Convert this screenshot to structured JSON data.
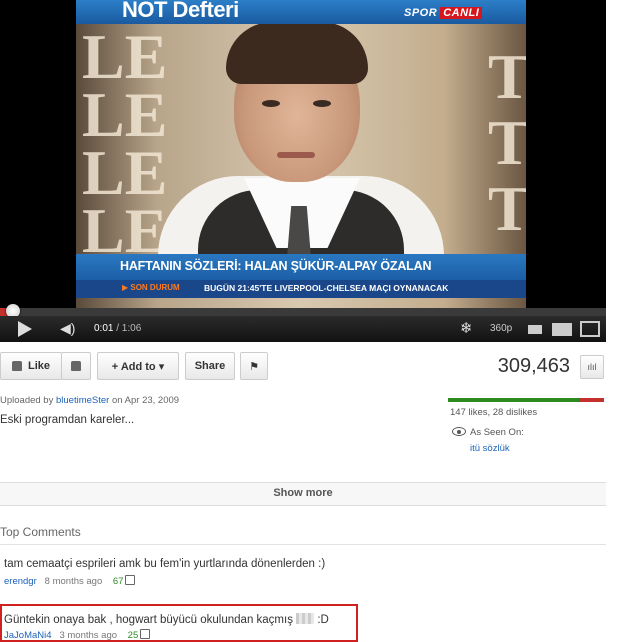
{
  "video": {
    "show_title": "NOT Defteri",
    "channel_logo_a": "SPOR",
    "channel_logo_b": "CANLI",
    "wall_letters": [
      "LE",
      "LE",
      "LE",
      "LE",
      "T",
      "T",
      "T"
    ],
    "caption": "HAFTANIN SÖZLERİ: HALAN ŞÜKÜR-ALPAY ÖZALAN",
    "ticker_label": "▶ SON DURUM",
    "ticker_text": "BUGÜN 21:45'TE LIVERPOOL-CHELSEA MAÇI OYNANACAK"
  },
  "player": {
    "current_time": "0:01",
    "duration": "/ 1:06",
    "progress_fraction": 0.015,
    "quality": "360p",
    "icons": [
      "play-icon",
      "volume-icon",
      "annotations-icon",
      "small-player-icon",
      "large-player-icon",
      "fullscreen-icon"
    ]
  },
  "actions": {
    "like": "Like",
    "add_to": "+ Add to ▾",
    "share": "Share",
    "view_count": "309,463",
    "stats_icon": "ılıl"
  },
  "description": {
    "uploaded_prefix": "Uploaded by ",
    "uploader": "bluetimeSter",
    "uploaded_suffix": " on Apr 23, 2009",
    "text": "Eski programdan kareler...",
    "likes": "147 likes, 28 dislikes",
    "like_fraction": 0.84,
    "seen_label": "As Seen On:",
    "seen_link": "itü sözlük",
    "show_more": "Show more"
  },
  "comments": {
    "heading": "Top Comments",
    "items": [
      {
        "text": "tam cemaatçi esprileri amk bu fem'in yurtlarında dönenlerden :)",
        "user": "erendgr",
        "age": "8 months ago",
        "votes": "67"
      },
      {
        "text_a": "Güntekin onaya bak , hogwart büyücü okulundan kaçmış",
        "text_b": " :D",
        "user": "JaJoMaNi4",
        "age": "3 months ago",
        "votes": "25"
      }
    ]
  },
  "colors": {
    "youtube_red": "#c4302b",
    "link_blue": "#1c62b9",
    "like_green": "#2b8b20",
    "highlight": "#d02020"
  }
}
